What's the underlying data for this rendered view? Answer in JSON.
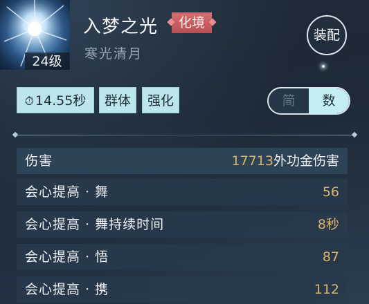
{
  "skill": {
    "name": "入梦之光",
    "tier": "化境",
    "subtitle": "寒光清月",
    "level": "24级",
    "icon": "glowing-orb-icon"
  },
  "actions": {
    "equip_label": "装配"
  },
  "tags": {
    "cooldown": "14.55秒",
    "cooldown_icon": "clock-icon",
    "target": "群体",
    "type": "强化"
  },
  "view_toggle": {
    "simple": "简",
    "number": "数",
    "selected": "数"
  },
  "stats": [
    {
      "label": "伤害",
      "value": "17713",
      "suffix": "外功金伤害"
    },
    {
      "label": "会心提高 · 舞",
      "value": "56",
      "suffix": ""
    },
    {
      "label": "会心提高 · 舞持续时间",
      "value": "8秒",
      "suffix": ""
    },
    {
      "label": "会心提高 · 悟",
      "value": "87",
      "suffix": ""
    },
    {
      "label": "会心提高 · 携",
      "value": "112",
      "suffix": ""
    }
  ],
  "colors": {
    "value": "#d9b46c",
    "tier_badge": "#c85a60",
    "tag_bg": "#bde6ec",
    "toggle_selected": "#c5eef2"
  }
}
